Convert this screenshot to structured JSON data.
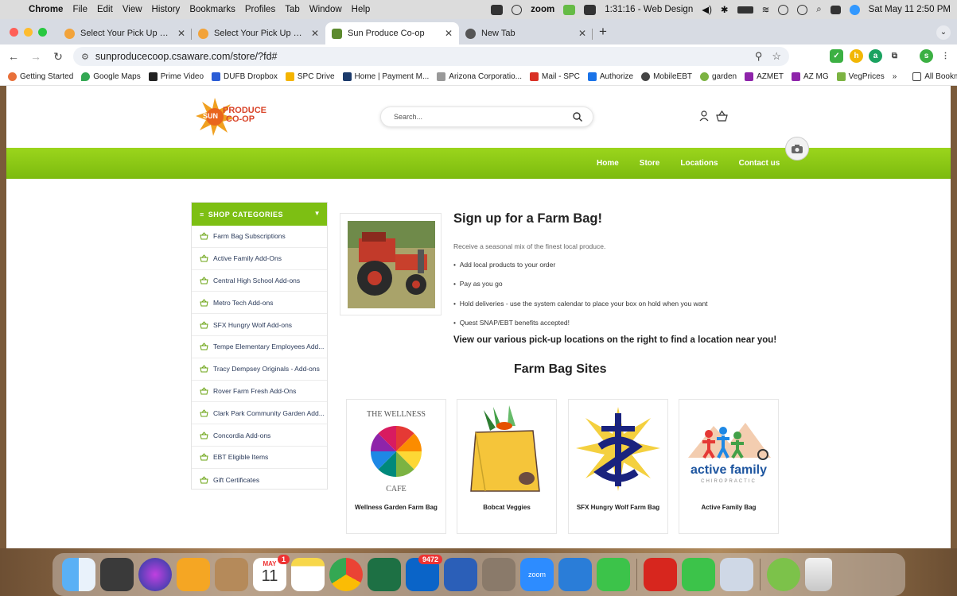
{
  "menubar": {
    "app_name": "Chrome",
    "menus": [
      "File",
      "Edit",
      "View",
      "History",
      "Bookmarks",
      "Profiles",
      "Tab",
      "Window",
      "Help"
    ],
    "zoom_label": "zoom",
    "timer": "1:31:16 - Web Design",
    "datetime": "Sat May 11  2:50 PM"
  },
  "tabs": [
    {
      "title": "Select Your Pick Up Site -",
      "fav_color": "#f2a33a"
    },
    {
      "title": "Select Your Pick Up Site -",
      "fav_color": "#f2a33a"
    },
    {
      "title": "Sun Produce Co-op",
      "fav_color": "#5c8a2e",
      "active": true
    },
    {
      "title": "New Tab",
      "fav_color": "#555555"
    }
  ],
  "address": {
    "url": "sunproducecoop.csaware.com/store/?fd#"
  },
  "bookmarks": [
    {
      "label": "Getting Started",
      "color": "#e8703a"
    },
    {
      "label": "Google Maps",
      "color": "#34a853"
    },
    {
      "label": "Prime Video",
      "color": "#222222"
    },
    {
      "label": "DUFB Dropbox",
      "color": "#2a5cd6"
    },
    {
      "label": "SPC Drive",
      "color": "#f4b400"
    },
    {
      "label": "Home | Payment M...",
      "color": "#1b3a6b"
    },
    {
      "label": "Arizona Corporatio...",
      "color": "#999999"
    },
    {
      "label": "Mail - SPC",
      "color": "#d93025"
    },
    {
      "label": "Authorize",
      "color": "#1a73e8"
    },
    {
      "label": "MobileEBT",
      "color": "#444444"
    },
    {
      "label": "garden",
      "color": "#7cb342"
    },
    {
      "label": "AZMET",
      "color": "#8e24aa"
    },
    {
      "label": "AZ MG",
      "color": "#8e24aa"
    },
    {
      "label": "VegPrices",
      "color": "#7cb342"
    }
  ],
  "bookmarks_overflow": "»",
  "all_bookmarks": "All Bookmarks",
  "site": {
    "logo_line1": "PRODUCE",
    "logo_line2": "CO-OP",
    "logo_sun": "SUN",
    "search_placeholder": "Search...",
    "nav": [
      "Home",
      "Store",
      "Locations",
      "Contact us"
    ],
    "sidebar_title": "SHOP CATEGORIES",
    "categories": [
      "Farm Bag Subscriptions",
      "Active Family Add-Ons",
      "Central High School Add-ons",
      "Metro Tech Add-ons",
      "SFX Hungry Wolf Add-ons",
      "Tempe Elementary Employees Add...",
      "Tracy Dempsey Originals - Add-ons",
      "Rover Farm Fresh Add-Ons",
      "Clark Park Community Garden Add...",
      "Concordia Add-ons",
      "EBT Eligible Items",
      "Gift Certificates"
    ],
    "heading": "Sign up for a Farm Bag!",
    "intro": "Receive a seasonal mix of the finest local produce.",
    "bullets": [
      "Add local products to your order",
      "Pay as you go",
      "Hold deliveries - use the system calendar to place your box on hold when you want",
      "Quest SNAP/EBT benefits accepted!"
    ],
    "cta": "View our various pick-up locations on the right to find a location near you!",
    "sites_heading": "Farm Bag Sites",
    "cards": [
      {
        "name": "Wellness Garden Farm Bag",
        "logo_text_top": "THE WELLNESS",
        "logo_text_bottom": "CAFE"
      },
      {
        "name": "Bobcat Veggies"
      },
      {
        "name": "SFX Hungry Wolf Farm Bag"
      },
      {
        "name": "Active Family Bag",
        "logo_text": "active family",
        "logo_sub": "CHIROPRACTIC"
      }
    ]
  },
  "dock": {
    "calendar_month": "MAY",
    "calendar_day": "11",
    "calendar_badge": "1",
    "outlook_badge": "9472",
    "zoom_label": "zoom"
  }
}
